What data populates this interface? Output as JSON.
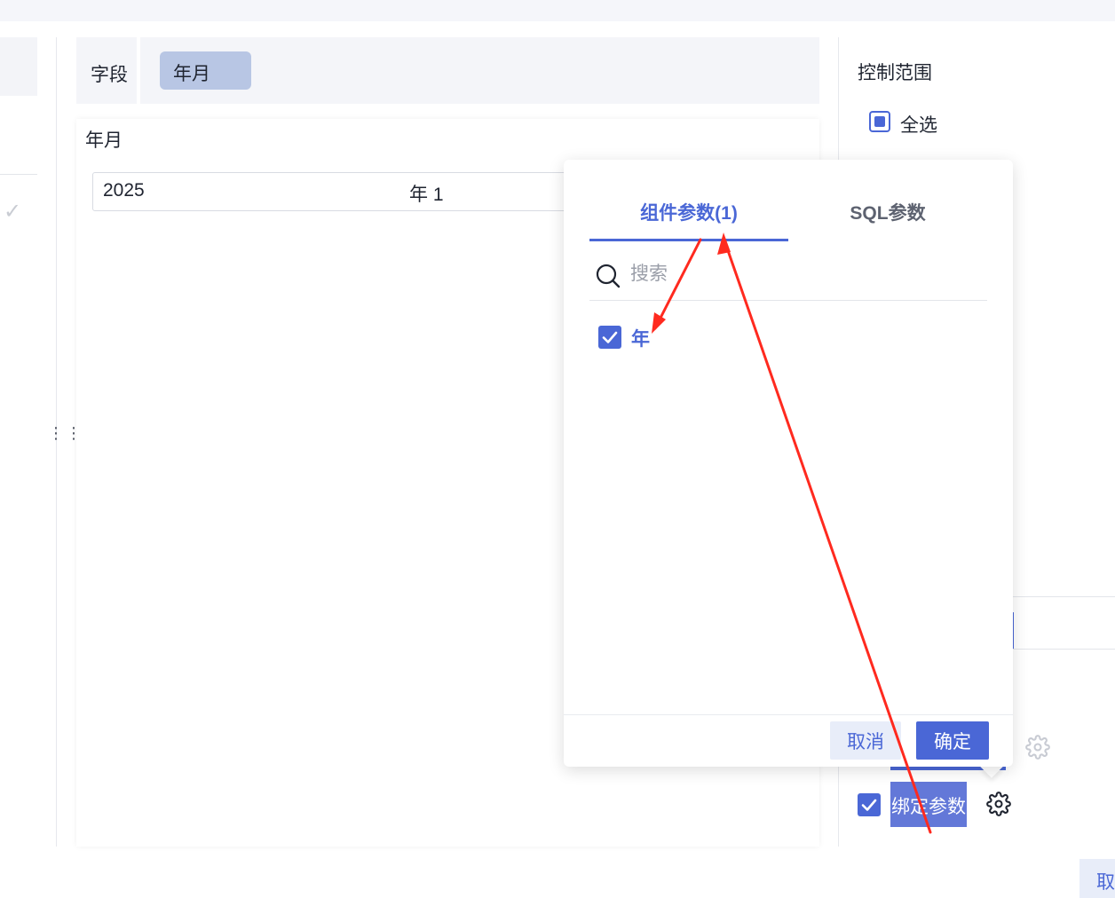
{
  "field": {
    "label": "字段",
    "chip": "年月"
  },
  "content": {
    "title": "年月",
    "date_year": "2025",
    "date_unit": "年  1"
  },
  "scope": {
    "title": "控制范围",
    "select_all": "全选"
  },
  "bind": {
    "label": "绑定参数"
  },
  "bottom_button": "取",
  "popover": {
    "tabs": [
      {
        "label": "组件参数(1)",
        "active": true
      },
      {
        "label": "SQL参数",
        "active": false
      }
    ],
    "search": {
      "placeholder": "搜索"
    },
    "params": [
      {
        "label": "年",
        "checked": true
      }
    ],
    "cancel": "取消",
    "confirm": "确定"
  },
  "colors": {
    "accent": "#4a67d6",
    "annotation": "#ff2a1f"
  },
  "icons": [
    "search-icon",
    "gear-icon",
    "check-icon",
    "drag-handle-icon"
  ]
}
